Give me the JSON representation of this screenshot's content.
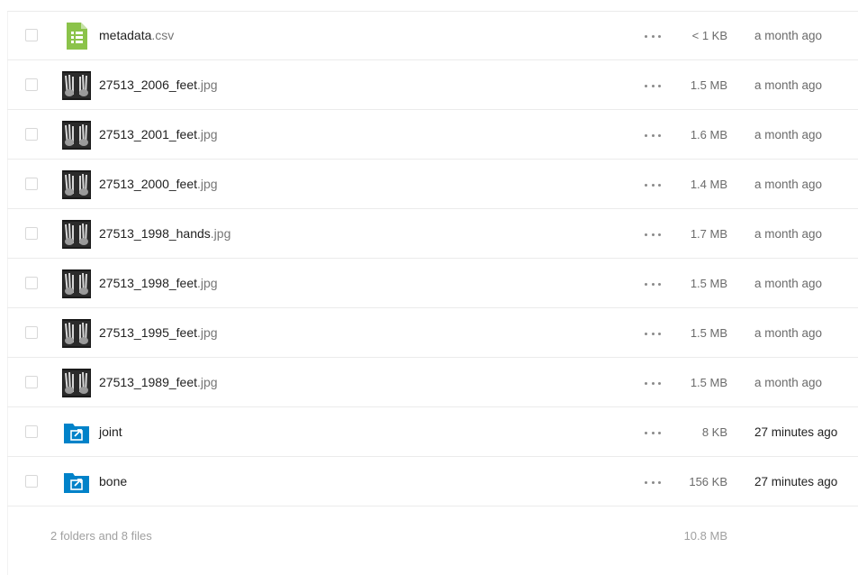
{
  "files": [
    {
      "name": "metadata",
      "ext": ".csv",
      "type": "spreadsheet",
      "icon": "spreadsheet-icon",
      "size": "< 1 KB",
      "modified": "a month ago",
      "recent": false
    },
    {
      "name": "27513_2006_feet",
      "ext": ".jpg",
      "type": "image",
      "icon": "xray-thumbnail",
      "size": "1.5 MB",
      "modified": "a month ago",
      "recent": false
    },
    {
      "name": "27513_2001_feet",
      "ext": ".jpg",
      "type": "image",
      "icon": "xray-thumbnail",
      "size": "1.6 MB",
      "modified": "a month ago",
      "recent": false
    },
    {
      "name": "27513_2000_feet",
      "ext": ".jpg",
      "type": "image",
      "icon": "xray-thumbnail",
      "size": "1.4 MB",
      "modified": "a month ago",
      "recent": false
    },
    {
      "name": "27513_1998_hands",
      "ext": ".jpg",
      "type": "image",
      "icon": "xray-thumbnail",
      "size": "1.7 MB",
      "modified": "a month ago",
      "recent": false
    },
    {
      "name": "27513_1998_feet",
      "ext": ".jpg",
      "type": "image",
      "icon": "xray-thumbnail",
      "size": "1.5 MB",
      "modified": "a month ago",
      "recent": false
    },
    {
      "name": "27513_1995_feet",
      "ext": ".jpg",
      "type": "image",
      "icon": "xray-thumbnail",
      "size": "1.5 MB",
      "modified": "a month ago",
      "recent": false
    },
    {
      "name": "27513_1989_feet",
      "ext": ".jpg",
      "type": "image",
      "icon": "xray-thumbnail",
      "size": "1.5 MB",
      "modified": "a month ago",
      "recent": false
    },
    {
      "name": "joint",
      "ext": "",
      "type": "shared-folder",
      "icon": "shared-folder-icon",
      "size": "8 KB",
      "modified": "27 minutes ago",
      "recent": true
    },
    {
      "name": "bone",
      "ext": "",
      "type": "shared-folder",
      "icon": "shared-folder-icon",
      "size": "156 KB",
      "modified": "27 minutes ago",
      "recent": true
    }
  ],
  "summary": {
    "count_label": "2 folders and 8 files",
    "total_size": "10.8 MB"
  },
  "colors": {
    "spreadsheet": "#8bc34a",
    "folder": "#0082c9",
    "text_muted": "#767676"
  }
}
